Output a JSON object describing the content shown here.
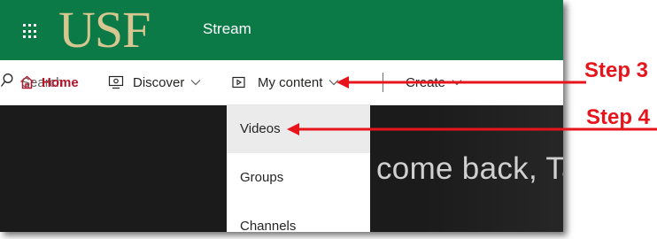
{
  "appbar": {
    "logo_text": "USF",
    "app_name": "Stream",
    "icon": "waffle-icon"
  },
  "nav": {
    "home": {
      "label": "Home",
      "icon": "home-icon"
    },
    "discover": {
      "label": "Discover",
      "icon": "discover-icon"
    },
    "my_content": {
      "label": "My content",
      "icon": "play-box-icon"
    },
    "create": {
      "label": "Create"
    },
    "search": {
      "placeholder": "Search",
      "icon": "search-icon"
    }
  },
  "my_content_menu": {
    "items": [
      {
        "label": "Videos"
      },
      {
        "label": "Groups"
      },
      {
        "label": "Channels"
      }
    ],
    "selected": "Videos"
  },
  "hero": {
    "welcome_text": "come back, Ta"
  },
  "annotations": {
    "step3": "Step 3",
    "step4": "Step 4",
    "color": "#e8141c"
  },
  "colors": {
    "brand_green": "#0b7a47",
    "logo_gold": "#d6c690",
    "home_accent": "#b3162b"
  }
}
